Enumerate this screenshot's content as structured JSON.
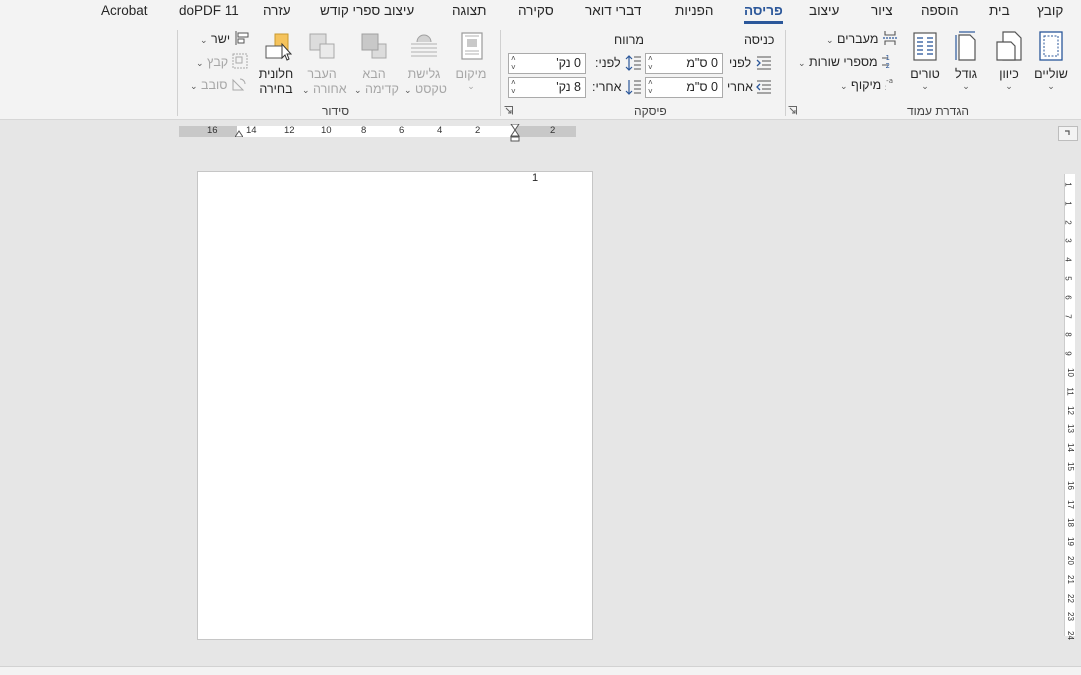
{
  "tabs": [
    {
      "id": "file",
      "label": "קובץ"
    },
    {
      "id": "home",
      "label": "בית"
    },
    {
      "id": "insert",
      "label": "הוספה"
    },
    {
      "id": "draw",
      "label": "ציור"
    },
    {
      "id": "design",
      "label": "עיצוב"
    },
    {
      "id": "layout",
      "label": "פריסה",
      "active": true
    },
    {
      "id": "references",
      "label": "הפניות"
    },
    {
      "id": "mailings",
      "label": "דברי דואר"
    },
    {
      "id": "review",
      "label": "סקירה"
    },
    {
      "id": "view",
      "label": "תצוגה"
    },
    {
      "id": "holybooks",
      "label": "עיצוב ספרי קודש"
    },
    {
      "id": "help",
      "label": "עזרה"
    },
    {
      "id": "dopdf",
      "label": "doPDF 11"
    },
    {
      "id": "acrobat",
      "label": "Acrobat"
    }
  ],
  "page_setup": {
    "group_label": "הגדרת עמוד",
    "margins": "שוליים",
    "orientation": "כיוון",
    "size": "גודל",
    "columns": "טורים",
    "breaks": "מעברים",
    "line_numbers": "מספרי שורות",
    "hyphenation": "מיקוף"
  },
  "paragraph": {
    "group_label": "פיסקה",
    "indent_header": "כניסה",
    "spacing_header": "מרווח",
    "indent_before_label": "לפני",
    "indent_after_label": "אחרי",
    "indent_before_value": "0 ס\"מ",
    "indent_after_value": "0 ס\"מ",
    "spacing_before_label": "לפני:",
    "spacing_after_label": "אחרי:",
    "spacing_before_value": "0 נק'",
    "spacing_after_value": "8 נק'"
  },
  "arrange": {
    "group_label": "סידור",
    "position": "מיקום",
    "wrap_text_1": "גלישת",
    "wrap_text_2": "טקסט",
    "bring_forward_1": "הבא",
    "bring_forward_2": "קדימה",
    "send_backward_1": "העבר",
    "send_backward_2": "אחורה",
    "selection_pane_1": "חלונית",
    "selection_pane_2": "בחירה",
    "align": "ישר",
    "group": "קבץ",
    "rotate": "סובב"
  },
  "ruler": {
    "h_numbers": [
      "16",
      "14",
      "12",
      "10",
      "8",
      "6",
      "4",
      "2",
      "2"
    ],
    "v_numbers": [
      "1",
      "1",
      "2",
      "3",
      "4",
      "5",
      "6",
      "7",
      "8",
      "9",
      "10",
      "11",
      "12",
      "13",
      "14",
      "15",
      "16",
      "17",
      "18",
      "19",
      "20",
      "21",
      "22",
      "23",
      "24"
    ]
  },
  "document": {
    "page_number": "1"
  },
  "colors": {
    "accent": "#2b579a",
    "ribbon_bg": "#f3f3f3",
    "workspace_bg": "#e6e6e6",
    "icon_blue": "#2b579a",
    "icon_highlight": "#f5c35c"
  }
}
